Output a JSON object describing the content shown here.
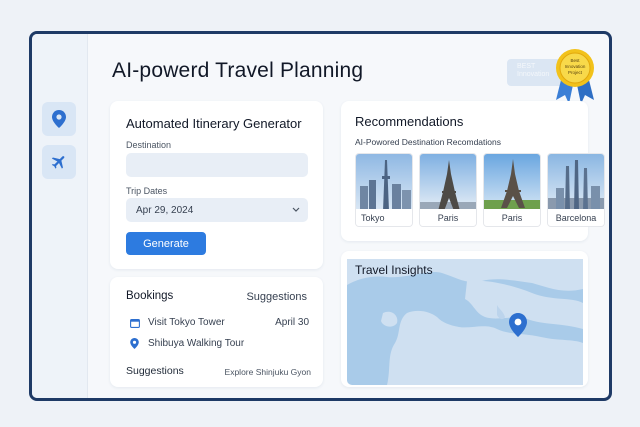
{
  "app": {
    "title": "AI-powerd Travel Planning"
  },
  "award": {
    "box_text": "BEST Innovation",
    "badge_text_1": "Best",
    "badge_text_2": "Innovation",
    "badge_text_3": "Project"
  },
  "sidebar": {
    "items": [
      {
        "icon": "location-pin-icon"
      },
      {
        "icon": "airplane-icon"
      }
    ]
  },
  "itinerary": {
    "title": "Automated Itinerary Generator",
    "destination_label": "Destination",
    "destination_value": "",
    "dates_label": "Trip Dates",
    "dates_value": "Apr 29, 2024",
    "generate_label": "Generate"
  },
  "bookings": {
    "title": "Bookings",
    "suggestions_link": "Suggestions",
    "items": [
      {
        "icon": "calendar-icon",
        "label": "Visit Tokyo Tower",
        "date": "April 30"
      },
      {
        "icon": "location-pin-icon",
        "label": "Shibuya Walking Tour",
        "date": ""
      }
    ],
    "footer_label": "Suggestions",
    "footer_link": "Explore Shinjuku Gyon"
  },
  "recommendations": {
    "title": "Recommendations",
    "subtitle": "AI-Powored Destination Recomdations",
    "destinations": [
      "Tokyo",
      "Paris",
      "Paris",
      "Barcelona"
    ]
  },
  "insights": {
    "title": "Travel Insights"
  },
  "colors": {
    "accent": "#2d7be0",
    "frame": "#1e3a66",
    "map_water": "#a9cbe9",
    "map_land": "#cfe0f1",
    "badge_gold": "#f2c21b"
  }
}
